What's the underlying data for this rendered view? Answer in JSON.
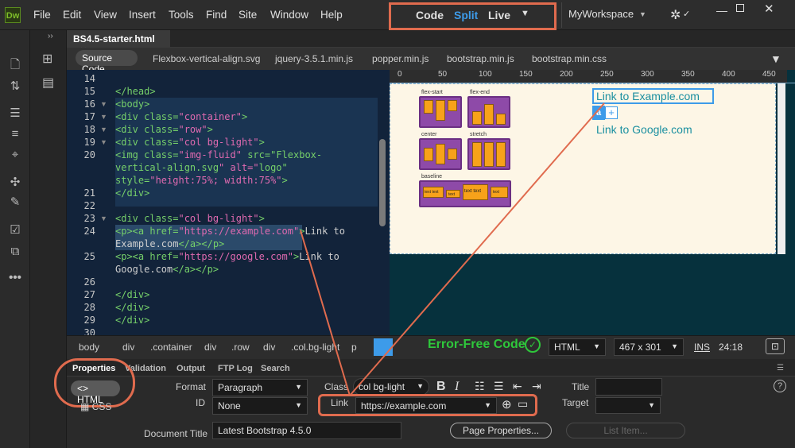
{
  "app": {
    "logo": "Dw"
  },
  "menu": [
    "File",
    "Edit",
    "View",
    "Insert",
    "Tools",
    "Find",
    "Site",
    "Window",
    "Help"
  ],
  "view_switcher": {
    "code": "Code",
    "split": "Split",
    "live": "Live"
  },
  "workspace": "MyWorkspace",
  "sidebar2": {
    "collapse": "››"
  },
  "document_tab": {
    "name": "BS4.5-starter.html",
    "close": "✕"
  },
  "related_files": [
    "Source Code",
    "Flexbox-vertical-align.svg",
    "jquery-3.5.1.min.js",
    "popper.min.js",
    "bootstrap.min.js",
    "bootstrap.min.css"
  ],
  "code_lines": [
    {
      "n": "14",
      "html": "",
      "fold": ""
    },
    {
      "n": "15",
      "text": "</head>",
      "fold": ""
    },
    {
      "n": "16",
      "text": "<body>",
      "fold": "▼"
    },
    {
      "n": "17",
      "text": "<div class=\"container\">",
      "fold": "▼"
    },
    {
      "n": "18",
      "text": "<div class=\"row\">",
      "fold": "▼"
    },
    {
      "n": "19",
      "text": "<div class=\"col bg-light\">",
      "fold": "▼"
    },
    {
      "n": "20",
      "text": "<img class=\"img-fluid\" src=\"Flexbox-",
      "fold": ""
    },
    {
      "n": "",
      "text": "vertical-align.svg\" alt=\"logo\"",
      "fold": ""
    },
    {
      "n": "",
      "text": "style=\"height:75%; width:75%\">",
      "fold": ""
    },
    {
      "n": "21",
      "text": "</div>",
      "fold": ""
    },
    {
      "n": "22",
      "text": "",
      "fold": ""
    },
    {
      "n": "23",
      "text": "<div class=\"col bg-light\">",
      "fold": "▼"
    },
    {
      "n": "24",
      "text": "<p><a href=\"https://example.com\">Link to",
      "fold": ""
    },
    {
      "n": "",
      "text": "Example.com</a></p>",
      "fold": ""
    },
    {
      "n": "25",
      "text": "<p><a href=\"https://google.com\">Link to",
      "fold": ""
    },
    {
      "n": "",
      "text": "Google.com</a></p>",
      "fold": ""
    },
    {
      "n": "26",
      "text": "",
      "fold": ""
    },
    {
      "n": "27",
      "text": "</div>",
      "fold": ""
    },
    {
      "n": "28",
      "text": "</div>",
      "fold": ""
    },
    {
      "n": "29",
      "text": "</div>",
      "fold": ""
    },
    {
      "n": "30",
      "text": "",
      "fold": ""
    }
  ],
  "ruler": [
    "0",
    "50",
    "100",
    "150",
    "200",
    "250",
    "300",
    "350",
    "400",
    "450"
  ],
  "live_view": {
    "flex_labels": [
      "flex-start",
      "flex-end",
      "center",
      "stretch",
      "baseline"
    ],
    "baseline_text": [
      "text text",
      "text",
      "text text",
      "text"
    ],
    "link1": "Link to Example.com",
    "link2": "Link to Google.com",
    "tag_badge": "a",
    "tag_plus": "+"
  },
  "status": {
    "breadcrumbs": [
      "body",
      "div",
      ".container",
      "div",
      ".row",
      "div",
      ".col.bg-light",
      "p",
      "a"
    ],
    "error_free": "Error-Free Code",
    "language": "HTML",
    "size": "467 x 301",
    "ins": "INS",
    "cursor": "24:18"
  },
  "properties": {
    "tabs": [
      "Properties",
      "Validation",
      "Output",
      "FTP Log",
      "Search"
    ],
    "html_btn": "HTML",
    "css_btn": "CSS",
    "format_label": "Format",
    "format_value": "Paragraph",
    "id_label": "ID",
    "id_value": "None",
    "class_label": "Class",
    "class_value": "col bg-light",
    "link_label": "Link",
    "link_value": "https://example.com",
    "title_label": "Title",
    "target_label": "Target",
    "doc_title_label": "Document Title",
    "doc_title_value": "Latest Bootstrap 4.5.0",
    "page_props": "Page Properties...",
    "list_item": "List Item...",
    "help": "?"
  },
  "colors": {
    "accent": "#e06b4e",
    "split_active": "#3d9be9",
    "link": "#1a8fa0",
    "error_free": "#2ec73b"
  }
}
